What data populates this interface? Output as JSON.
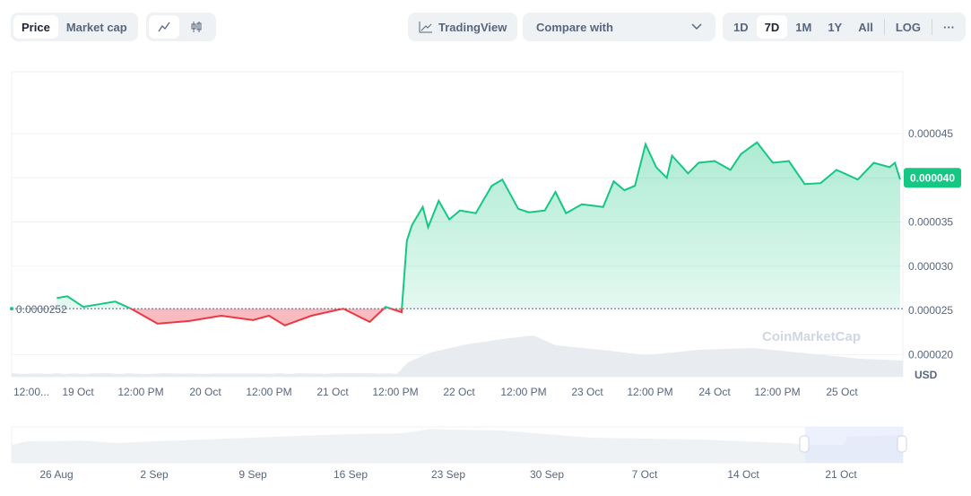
{
  "toolbar": {
    "metric_tabs": [
      "Price",
      "Market cap"
    ],
    "active_metric": "Price",
    "chart_types": [
      "line-chart-icon",
      "candlestick-icon"
    ],
    "tradingview_label": "TradingView",
    "compare_label": "Compare with",
    "ranges": [
      "1D",
      "7D",
      "1M",
      "1Y",
      "All"
    ],
    "active_range": "7D",
    "log_label": "LOG",
    "more_label": "···"
  },
  "colors": {
    "up": "#16c784",
    "down": "#ea3943",
    "grid": "#eff2f5",
    "text": "#58667e"
  },
  "watermark": "CoinMarketCap",
  "chart_data": {
    "type": "area",
    "currency_label": "USD",
    "baseline_value": 2.52e-05,
    "baseline_label": "0.0000252",
    "current_price_label": "0.000040",
    "ylim": [
      1.75e-05,
      5.2e-05
    ],
    "xlim": [
      "18 Oct 11:30",
      "25 Oct 11:30"
    ],
    "y_ticks": [
      "0.000045",
      "0.000035",
      "0.000030",
      "0.000025",
      "0.000020"
    ],
    "x_ticks": [
      "12:00...",
      "19 Oct",
      "12:00 PM",
      "20 Oct",
      "12:00 PM",
      "21 Oct",
      "12:00 PM",
      "22 Oct",
      "12:00 PM",
      "23 Oct",
      "12:00 PM",
      "24 Oct",
      "12:00 PM",
      "25 Oct"
    ],
    "grid": true,
    "series": [
      {
        "points": [
          [
            "18 Oct 20:00",
            2.64e-05
          ],
          [
            "18 Oct 22:00",
            2.66e-05
          ],
          [
            "19 Oct 01:00",
            2.54e-05
          ],
          [
            "19 Oct 04:00",
            2.57e-05
          ],
          [
            "19 Oct 07:00",
            2.6e-05
          ],
          [
            "19 Oct 10:00",
            2.52e-05
          ],
          [
            "19 Oct 15:00",
            2.35e-05
          ],
          [
            "19 Oct 21:00",
            2.38e-05
          ],
          [
            "20 Oct 03:00",
            2.44e-05
          ],
          [
            "20 Oct 09:00",
            2.39e-05
          ],
          [
            "20 Oct 12:00",
            2.44e-05
          ],
          [
            "20 Oct 15:00",
            2.33e-05
          ],
          [
            "20 Oct 20:00",
            2.44e-05
          ],
          [
            "21 Oct 02:00",
            2.52e-05
          ],
          [
            "21 Oct 05:00",
            2.43e-05
          ],
          [
            "21 Oct 07:00",
            2.37e-05
          ],
          [
            "21 Oct 10:00",
            2.54e-05
          ],
          [
            "21 Oct 13:00",
            2.48e-05
          ],
          [
            "21 Oct 14:00",
            3.29e-05
          ],
          [
            "21 Oct 15:00",
            3.47e-05
          ],
          [
            "21 Oct 17:00",
            3.67e-05
          ],
          [
            "21 Oct 18:00",
            3.44e-05
          ],
          [
            "21 Oct 20:00",
            3.74e-05
          ],
          [
            "21 Oct 22:00",
            3.53e-05
          ],
          [
            "22 Oct 00:00",
            3.63e-05
          ],
          [
            "22 Oct 03:00",
            3.6e-05
          ],
          [
            "22 Oct 06:00",
            3.91e-05
          ],
          [
            "22 Oct 08:00",
            3.98e-05
          ],
          [
            "22 Oct 11:00",
            3.65e-05
          ],
          [
            "22 Oct 13:00",
            3.61e-05
          ],
          [
            "22 Oct 16:00",
            3.63e-05
          ],
          [
            "22 Oct 18:00",
            3.84e-05
          ],
          [
            "22 Oct 20:00",
            3.6e-05
          ],
          [
            "22 Oct 23:00",
            3.7e-05
          ],
          [
            "23 Oct 03:00",
            3.67e-05
          ],
          [
            "23 Oct 05:00",
            3.96e-05
          ],
          [
            "23 Oct 07:00",
            3.86e-05
          ],
          [
            "23 Oct 09:00",
            3.91e-05
          ],
          [
            "23 Oct 11:00",
            4.38e-05
          ],
          [
            "23 Oct 13:00",
            4.12e-05
          ],
          [
            "23 Oct 15:00",
            4e-05
          ],
          [
            "23 Oct 16:00",
            4.25e-05
          ],
          [
            "23 Oct 19:00",
            4.05e-05
          ],
          [
            "23 Oct 21:00",
            4.17e-05
          ],
          [
            "24 Oct 00:00",
            4.19e-05
          ],
          [
            "24 Oct 03:00",
            4.09e-05
          ],
          [
            "24 Oct 05:00",
            4.27e-05
          ],
          [
            "24 Oct 08:00",
            4.4e-05
          ],
          [
            "24 Oct 11:00",
            4.17e-05
          ],
          [
            "24 Oct 14:00",
            4.19e-05
          ],
          [
            "24 Oct 17:00",
            3.93e-05
          ],
          [
            "24 Oct 20:00",
            3.94e-05
          ],
          [
            "24 Oct 23:00",
            4.09e-05
          ],
          [
            "25 Oct 03:00",
            3.98e-05
          ],
          [
            "25 Oct 06:00",
            4.17e-05
          ],
          [
            "25 Oct 09:00",
            4.12e-05
          ],
          [
            "25 Oct 10:00",
            4.17e-05
          ],
          [
            "25 Oct 11:00",
            3.98e-05
          ]
        ]
      }
    ],
    "navigator_ticks": [
      "26 Aug",
      "2 Sep",
      "9 Sep",
      "16 Sep",
      "23 Sep",
      "30 Sep",
      "7 Oct",
      "14 Oct",
      "21 Oct"
    ]
  }
}
